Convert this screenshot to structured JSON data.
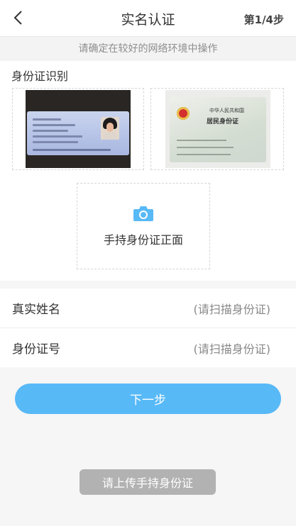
{
  "header": {
    "title": "实名认证",
    "step": "第1/4步",
    "back_icon": "chevron-left-icon"
  },
  "notice": "请确定在较好的网络环境中操作",
  "id_upload": {
    "section_title": "身份证识别",
    "hand_held_label": "手持身份证正面",
    "hand_held_icon": "camera-icon"
  },
  "form": {
    "name_label": "真实姓名",
    "name_value": "(请扫描身份证)",
    "id_label": "身份证号",
    "id_value": "(请扫描身份证)"
  },
  "next_button": "下一步",
  "toast": "请上传手持身份证",
  "colors": {
    "accent": "#58b9f7",
    "toast_bg": "#b2b2b2",
    "page_bg": "#f6f6f6"
  }
}
